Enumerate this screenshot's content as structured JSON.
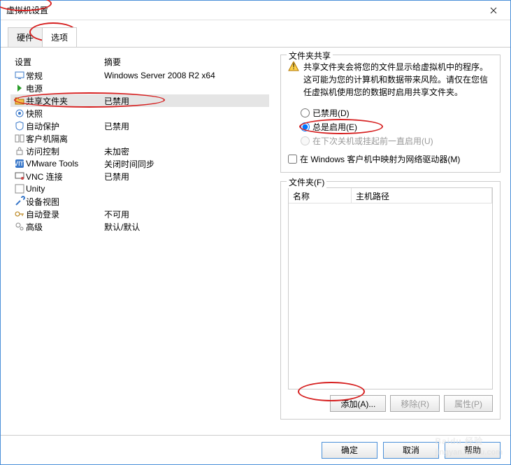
{
  "window": {
    "title": "虚拟机设置"
  },
  "tabs": {
    "hardware": "硬件",
    "options": "选项"
  },
  "list": {
    "hdr_setting": "设置",
    "hdr_summary": "摘要",
    "rows": [
      {
        "label": "常规",
        "summary": "Windows Server 2008 R2 x64",
        "icon": "monitor"
      },
      {
        "label": "电源",
        "summary": "",
        "icon": "power"
      },
      {
        "label": "共享文件夹",
        "summary": "已禁用",
        "icon": "folder",
        "selected": true
      },
      {
        "label": "快照",
        "summary": "",
        "icon": "camera"
      },
      {
        "label": "自动保护",
        "summary": "已禁用",
        "icon": "shield"
      },
      {
        "label": "客户机隔离",
        "summary": "",
        "icon": "isolate"
      },
      {
        "label": "访问控制",
        "summary": "未加密",
        "icon": "lock"
      },
      {
        "label": "VMware Tools",
        "summary": "关闭时间同步",
        "icon": "tools"
      },
      {
        "label": "VNC 连接",
        "summary": "已禁用",
        "icon": "vnc"
      },
      {
        "label": "Unity",
        "summary": "",
        "icon": "unity"
      },
      {
        "label": "设备视图",
        "summary": "",
        "icon": "wrench"
      },
      {
        "label": "自动登录",
        "summary": "不可用",
        "icon": "key"
      },
      {
        "label": "高级",
        "summary": "默认/默认",
        "icon": "gears"
      }
    ]
  },
  "share": {
    "legend": "文件夹共享",
    "warning": "共享文件夹会将您的文件显示给虚拟机中的程序。这可能为您的计算机和数据带来风险。请仅在您信任虚拟机使用您的数据时启用共享文件夹。",
    "radios": {
      "disabled": "已禁用(D)",
      "always": "总是启用(E)",
      "until_off": "在下次关机或挂起前一直启用(U)"
    },
    "checkbox": "在 Windows 客户机中映射为网络驱动器(M)"
  },
  "folders": {
    "legend": "文件夹(F)",
    "col_name": "名称",
    "col_path": "主机路径",
    "btn_add": "添加(A)...",
    "btn_remove": "移除(R)",
    "btn_props": "属性(P)"
  },
  "buttons": {
    "ok": "确定",
    "cancel": "取消",
    "help": "帮助"
  },
  "watermark": {
    "brand": "Baidu 经验",
    "sub": "jingyan.baidu.com"
  }
}
